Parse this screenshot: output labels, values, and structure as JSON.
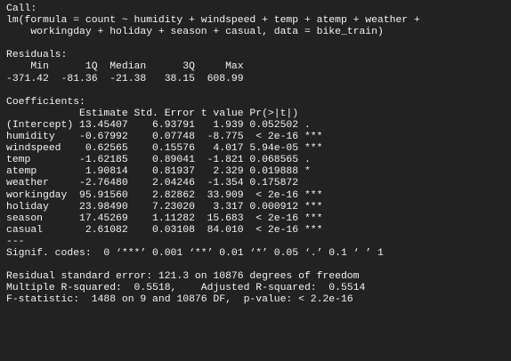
{
  "console": {
    "lines": [
      "Call:",
      "lm(formula = count ~ humidity + windspeed + temp + atemp + weather +",
      "    workingday + holiday + season + casual, data = bike_train)",
      "",
      "Residuals:",
      "    Min      1Q  Median      3Q     Max ",
      "-371.42  -81.36  -21.38   38.15  608.99 ",
      "",
      "Coefficients:",
      "            Estimate Std. Error t value Pr(>|t|)    ",
      "(Intercept) 13.45407    6.93791   1.939 0.052502 .  ",
      "humidity    -0.67992    0.07748  -8.775  < 2e-16 ***",
      "windspeed    0.62565    0.15576   4.017 5.94e-05 ***",
      "temp        -1.62185    0.89041  -1.821 0.068565 .  ",
      "atemp        1.90814    0.81937   2.329 0.019888 *  ",
      "weather     -2.76480    2.04246  -1.354 0.175872    ",
      "workingday  95.91560    2.82862  33.909  < 2e-16 ***",
      "holiday     23.98490    7.23020   3.317 0.000912 ***",
      "season      17.45269    1.11282  15.683  < 2e-16 ***",
      "casual       2.61082    0.03108  84.010  < 2e-16 ***",
      "---",
      "Signif. codes:  0 ‘***’ 0.001 ‘**’ 0.01 ‘*’ 0.05 ‘.’ 0.1 ‘ ’ 1",
      "",
      "Residual standard error: 121.3 on 10876 degrees of freedom",
      "Multiple R-squared:  0.5518,\tAdjusted R-squared:  0.5514 ",
      "F-statistic:  1488 on 9 and 10876 DF,  p-value: < 2.2e-16"
    ]
  }
}
